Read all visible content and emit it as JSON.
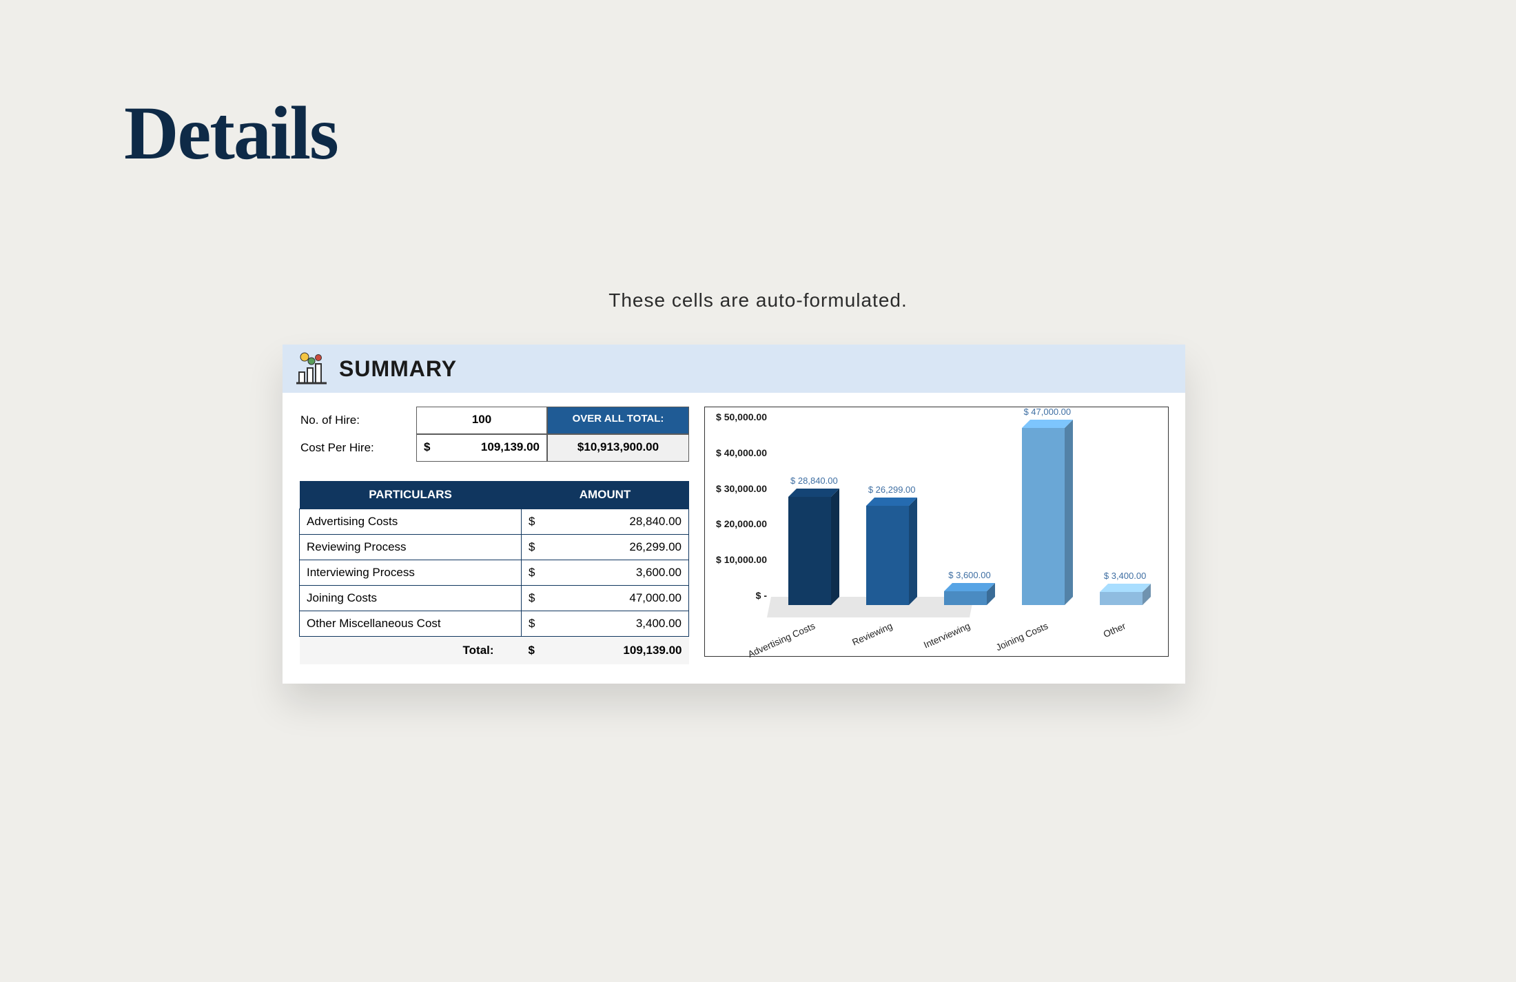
{
  "page": {
    "title": "Details",
    "subtitle": "These cells are auto-formulated."
  },
  "summary": {
    "label": "SUMMARY",
    "hire_label": "No. of Hire:",
    "hire_value": "100",
    "overall_label": "OVER ALL TOTAL:",
    "cph_label": "Cost Per Hire:",
    "cph_currency": "$",
    "cph_value": "109,139.00",
    "overall_value": "$10,913,900.00"
  },
  "table": {
    "col1": "PARTICULARS",
    "col2": "AMOUNT",
    "rows": [
      {
        "name": "Advertising Costs",
        "cur": "$",
        "amount": "28,840.00"
      },
      {
        "name": "Reviewing Process",
        "cur": "$",
        "amount": "26,299.00"
      },
      {
        "name": "Interviewing Process",
        "cur": "$",
        "amount": "3,600.00"
      },
      {
        "name": "Joining Costs",
        "cur": "$",
        "amount": "47,000.00"
      },
      {
        "name": "Other Miscellaneous Cost",
        "cur": "$",
        "amount": "3,400.00"
      }
    ],
    "total_label": "Total:",
    "total_currency": "$",
    "total_value": "109,139.00"
  },
  "chart_data": {
    "type": "bar",
    "categories": [
      "Advertising Costs",
      "Reviewing",
      "Interviewing",
      "Joining Costs",
      "Other"
    ],
    "values": [
      28840,
      26299,
      3600,
      47000,
      3400
    ],
    "value_labels": [
      "$ 28,840.00",
      "$ 26,299.00",
      "$ 3,600.00",
      "$ 47,000.00",
      "$ 3,400.00"
    ],
    "ylim": [
      0,
      50000
    ],
    "y_ticks": [
      "$ 50,000.00",
      "$ 40,000.00",
      "$ 30,000.00",
      "$ 20,000.00",
      "$ 10,000.00",
      "$ -"
    ],
    "colors": [
      "#113a63",
      "#1f5b95",
      "#4a8bc2",
      "#6aa7d6",
      "#8fbce0"
    ],
    "title": "",
    "xlabel": "",
    "ylabel": ""
  }
}
